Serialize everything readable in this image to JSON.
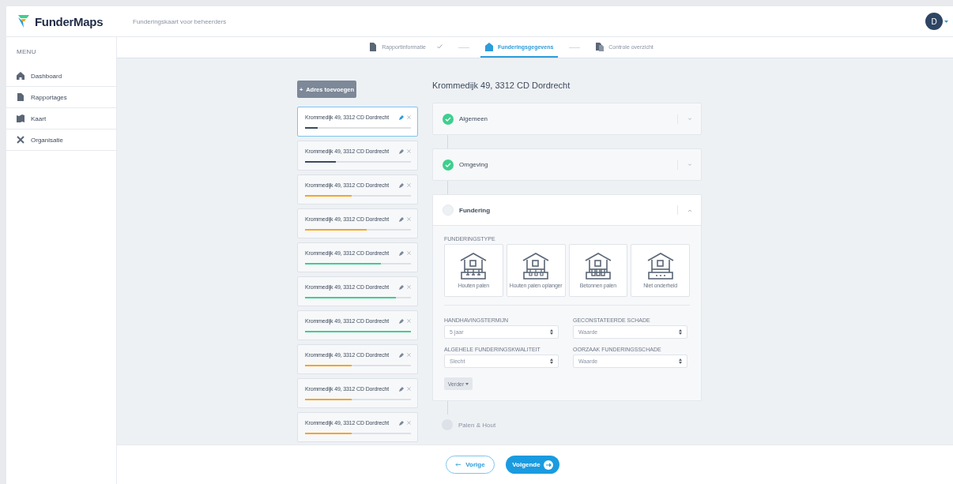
{
  "header": {
    "brand": "FunderMaps",
    "subtitle": "Funderingskaart voor beheerders",
    "avatar": "D"
  },
  "sidebar": {
    "heading": "MENU",
    "items": [
      {
        "label": "Dashboard"
      },
      {
        "label": "Rapportages"
      },
      {
        "label": "Kaart"
      },
      {
        "label": "Organisatie"
      }
    ]
  },
  "steps": [
    {
      "label": "Rapportinformatie",
      "done": true,
      "selected": false
    },
    {
      "label": "Funderingsgegevens",
      "done": false,
      "selected": true
    },
    {
      "label": "Controle overzicht",
      "done": false,
      "selected": false
    }
  ],
  "add_button": "+  Adres toevoegen",
  "addresses": [
    {
      "label": "Krommedijk 49, 3312 CD Dordrecht",
      "selected": true,
      "level": 0.12,
      "color": "#3d4a5c"
    },
    {
      "label": "Krommedijk 49, 3312 CD Dordrecht",
      "selected": false,
      "level": 0.29,
      "color": "#3d4a5c"
    },
    {
      "label": "Krommedijk 49, 3312 CD Dordrecht",
      "selected": false,
      "level": 0.44,
      "color": "#f5a623"
    },
    {
      "label": "Krommedijk 49, 3312 CD Dordrecht",
      "selected": false,
      "level": 0.58,
      "color": "#f5a623"
    },
    {
      "label": "Krommedijk 49, 3312 CD Dordrecht",
      "selected": false,
      "level": 0.72,
      "color": "#3ecf8e"
    },
    {
      "label": "Krommedijk 49, 3312 CD Dordrecht",
      "selected": false,
      "level": 0.86,
      "color": "#3ecf8e"
    },
    {
      "label": "Krommedijk 49, 3312 CD Dordrecht",
      "selected": false,
      "level": 1,
      "color": "#3ecf8e"
    },
    {
      "label": "Krommedijk 49, 3312 CD Dordrecht",
      "selected": false,
      "level": 0.44,
      "color": "#f5a623"
    },
    {
      "label": "Krommedijk 49, 3312 CD Dordrecht",
      "selected": false,
      "level": 0.44,
      "color": "#f5a623"
    },
    {
      "label": "Krommedijk 49, 3312 CD Dordrecht",
      "selected": false,
      "level": 0.44,
      "color": "#f5a623"
    }
  ],
  "address_title": "Krommedijk 49, 3312 CD Dordrecht",
  "sections": [
    {
      "title": "Algemeen",
      "kind": "collapsed",
      "checked": true
    },
    {
      "title": "Omgeving",
      "kind": "collapsed",
      "checked": true
    },
    {
      "title": "Fundering",
      "kind": "expanded",
      "checked": false,
      "type_label": "FUNDERINGSTYPE",
      "types": [
        {
          "label": "Houten palen",
          "selected": false
        },
        {
          "label": "Houten palen oplanger",
          "selected": false
        },
        {
          "label": "Betonnen palen",
          "selected": false
        },
        {
          "label": "Niet onderheid",
          "selected": false
        }
      ],
      "fields": [
        {
          "label": "HANDHAVINGSTERMIJN",
          "value": "5 jaar"
        },
        {
          "label": "GECONSTATEERDE SCHADE",
          "value": "Waarde"
        },
        {
          "label": "ALGEHELE FUNDERINGSKWALITEIT",
          "value": "Slecht"
        },
        {
          "label": "OORZAAK FUNDERINGSSCHADE",
          "value": "Waarde"
        }
      ],
      "more_button": "Verder"
    },
    {
      "title": "Palen & Hout",
      "kind": "upcoming",
      "checked": false
    }
  ],
  "footer": {
    "back": "Vorige",
    "next": "Volgende"
  }
}
